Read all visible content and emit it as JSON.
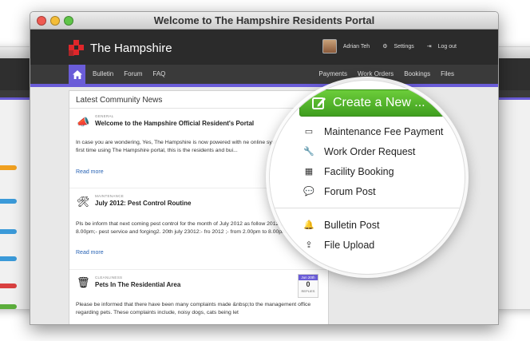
{
  "window": {
    "title": "Welcome to The Hampshire Residents Portal"
  },
  "brand": {
    "name": "The Hampshire",
    "accent": "#6a5cd8",
    "logo_color": "#e0262a",
    "create_color": "#4caf25"
  },
  "user": {
    "name": "Adrian Teh",
    "settings": "Settings",
    "logout": "Log out"
  },
  "nav": {
    "left": [
      "Bulletin",
      "Forum",
      "FAQ"
    ],
    "right": [
      "Payments",
      "Work Orders",
      "Bookings",
      "Files"
    ]
  },
  "news": {
    "title": "Latest Community News",
    "posts": [
      {
        "category": "GENERAL",
        "title": "Welcome to the Hampshire Official Resident's Portal",
        "icon": "megaphone-icon",
        "body": "In case you are wondering, Yes, The Hampshire is now powered with ne online system! If this is your first time using The Hampshire portal, this is the residents and bui...",
        "more": "Read more"
      },
      {
        "category": "MAINTENANCE",
        "title": "July 2012: Pest Control Routine",
        "icon": "tools-icon",
        "body": "Pls be inform that next coming pest control for the month of July 2012 as follow 2012 ;- from 2.00pm to 8.00pm;- pest service and forging2. 20th july 23012:- fro 2012 ;- from 2.00pm to 8.00pm;- Fo...",
        "more": "Read more"
      },
      {
        "category": "CLEANLINESS",
        "title": "Pets In The Residential Area",
        "icon": "trash-icon",
        "body": "Please be informed that there have been many complaints made &nbsp;to the management office regarding pets. These complaints include, noisy dogs, cats being let",
        "date": "Jun 20th",
        "replies_count": "0",
        "replies_label": "REPLIES"
      }
    ]
  },
  "create": {
    "label": "Create a New ...",
    "items": [
      {
        "label": "Maintenance Fee Payment",
        "icon": "card-icon"
      },
      {
        "label": "Work Order Request",
        "icon": "wrench-icon"
      },
      {
        "label": "Facility Booking",
        "icon": "calendar-icon"
      },
      {
        "label": "Forum Post",
        "icon": "chat-icon"
      }
    ],
    "items2": [
      {
        "label": "Bulletin Post",
        "icon": "bell-icon"
      },
      {
        "label": "File Upload",
        "icon": "upload-icon"
      }
    ]
  }
}
